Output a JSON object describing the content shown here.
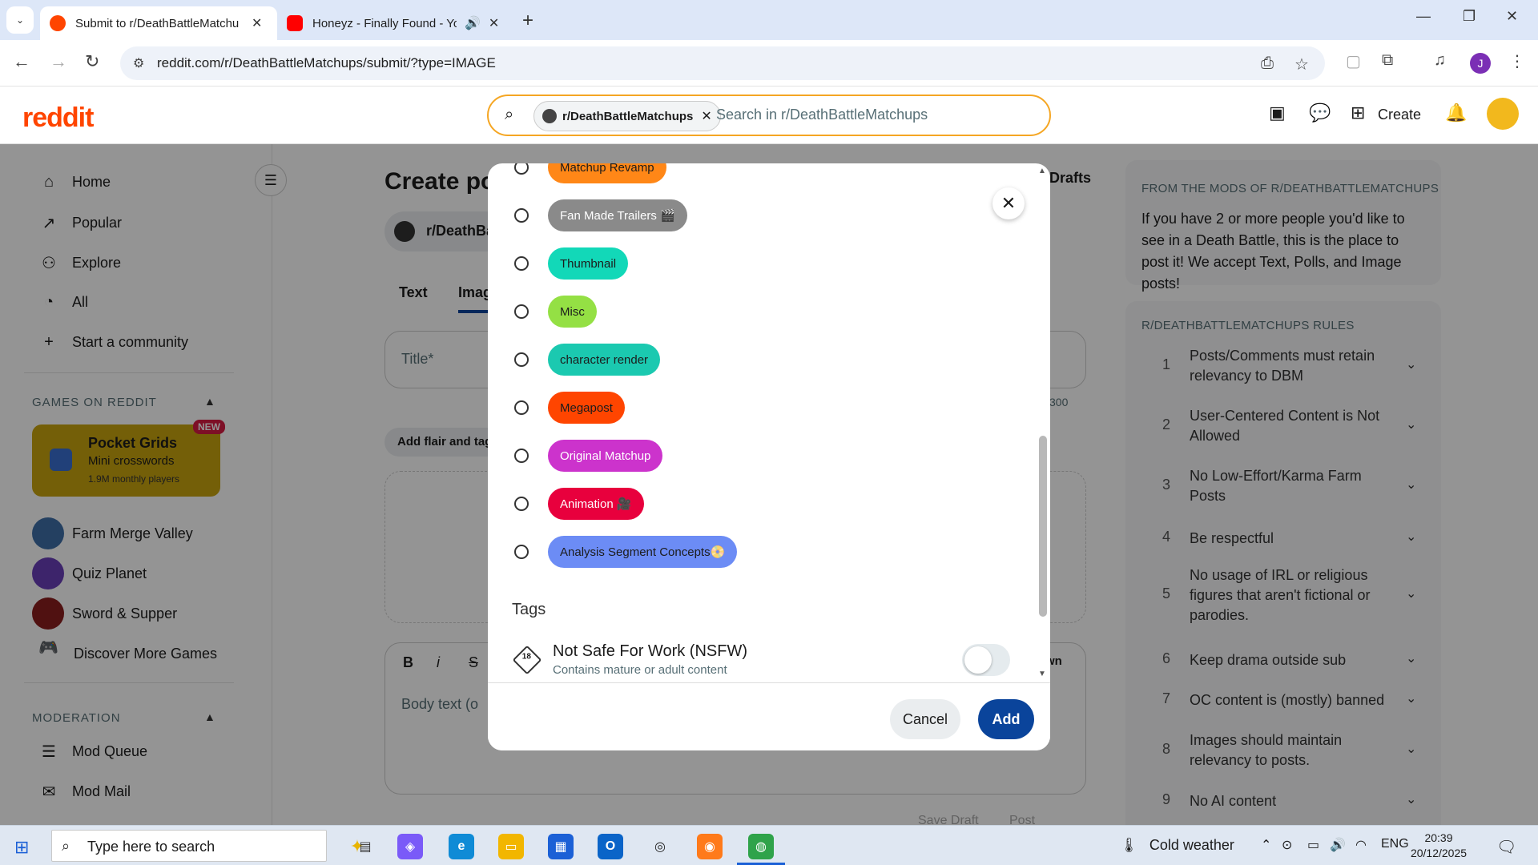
{
  "browser": {
    "tabs": [
      {
        "title": "Submit to r/DeathBattleMatchu",
        "active": true
      },
      {
        "title": "Honeyz - Finally Found - Yo",
        "active": false
      }
    ],
    "url": "reddit.com/r/DeathBattleMatchups/submit/?type=IMAGE",
    "profile_initial": "J"
  },
  "reddit_header": {
    "logo": "reddit",
    "search_chip": "r/DeathBattleMatchups",
    "search_placeholder": "Search in r/DeathBattleMatchups",
    "create_label": "Create"
  },
  "sidebar": {
    "nav": [
      {
        "label": "Home",
        "icon": "home-icon"
      },
      {
        "label": "Popular",
        "icon": "popular-icon"
      },
      {
        "label": "Explore",
        "icon": "explore-icon"
      },
      {
        "label": "All",
        "icon": "all-icon"
      },
      {
        "label": "Start a community",
        "icon": "plus-icon"
      }
    ],
    "games_title": "GAMES ON REDDIT",
    "game_card": {
      "title": "Pocket Grids",
      "subtitle": "Mini crosswords",
      "players": "1.9M monthly players",
      "badge": "NEW"
    },
    "games": [
      "Farm Merge Valley",
      "Quiz Planet",
      "Sword & Supper",
      "Discover More Games"
    ],
    "moderation_title": "MODERATION",
    "moderation": [
      "Mod Queue",
      "Mod Mail"
    ]
  },
  "main": {
    "heading": "Create po",
    "community": "r/DeathBa",
    "tabs": [
      "Text",
      "Imag"
    ],
    "title_placeholder": "Title*",
    "char_count": "300",
    "flair_button": "Add flair and tag",
    "body_placeholder": "Body text (o",
    "drafts": "Drafts",
    "markdown_label": "wn",
    "save_draft": "Save Draft",
    "post": "Post"
  },
  "right_panel": {
    "mods_title": "FROM THE MODS OF R/DEATHBATTLEMATCHUPS",
    "mods_desc": "If you have 2 or more people you'd like to see in a Death Battle, this is the place to post it! We accept Text, Polls, and Image posts!",
    "rules_title": "R/DEATHBATTLEMATCHUPS RULES",
    "rules": [
      {
        "num": "1",
        "text": "Posts/Comments must retain relevancy to DBM"
      },
      {
        "num": "2",
        "text": "User-Centered Content is Not Allowed"
      },
      {
        "num": "3",
        "text": "No Low-Effort/Karma Farm Posts"
      },
      {
        "num": "4",
        "text": "Be respectful"
      },
      {
        "num": "5",
        "text": "No usage of IRL or religious figures that aren't fictional or parodies."
      },
      {
        "num": "6",
        "text": "Keep drama outside sub"
      },
      {
        "num": "7",
        "text": "OC content is (mostly) banned"
      },
      {
        "num": "8",
        "text": "Images should maintain relevancy to posts."
      },
      {
        "num": "9",
        "text": "No AI content"
      }
    ]
  },
  "modal": {
    "flairs": [
      {
        "label": "Matchup Revamp",
        "bg": "#ff8717",
        "fg": "#1c1c1c"
      },
      {
        "label": "Fan Made Trailers 🎬",
        "bg": "#8a8a8a",
        "fg": "#ffffff"
      },
      {
        "label": "Thumbnail",
        "bg": "#12d8b8",
        "fg": "#1c1c1c"
      },
      {
        "label": "Misc",
        "bg": "#94e044",
        "fg": "#1c1c1c"
      },
      {
        "label": "character render",
        "bg": "#1bc9b0",
        "fg": "#1c1c1c"
      },
      {
        "label": "Megapost",
        "bg": "#ff4500",
        "fg": "#1c1c1c"
      },
      {
        "label": "Original Matchup",
        "bg": "#cc33cc",
        "fg": "#ffffff"
      },
      {
        "label": "Animation 🎥",
        "bg": "#e8003d",
        "fg": "#ffffff"
      },
      {
        "label": "Analysis Segment Concepts📀",
        "bg": "#6c8cf5",
        "fg": "#1c1c1c"
      }
    ],
    "tags_title": "Tags",
    "nsfw_badge": "18",
    "nsfw_title": "Not Safe For Work (NSFW)",
    "nsfw_desc": "Contains mature or adult content",
    "nsfw_enabled": false,
    "cancel_label": "Cancel",
    "add_label": "Add"
  },
  "taskbar": {
    "search_placeholder": "Type here to search",
    "weather": "Cold weather",
    "language": "ENG",
    "time": "20:39",
    "date": "20/12/2025"
  }
}
